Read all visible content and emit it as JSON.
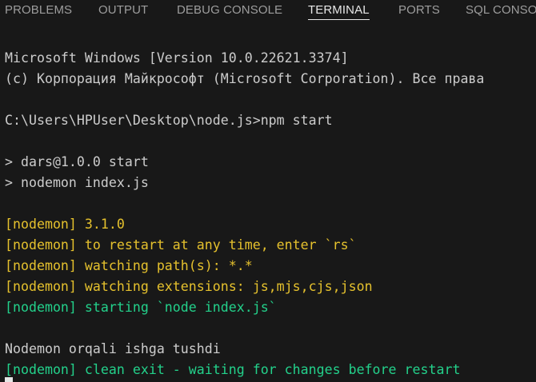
{
  "tabs": [
    {
      "label": "PROBLEMS"
    },
    {
      "label": "OUTPUT"
    },
    {
      "label": "DEBUG CONSOLE"
    },
    {
      "label": "TERMINAL"
    },
    {
      "label": "PORTS"
    },
    {
      "label": "SQL CONSO"
    }
  ],
  "active_tab": "TERMINAL",
  "colors": {
    "background": "#181818",
    "text": "#cccccc",
    "nodemon_info": "#e5c12d",
    "nodemon_status": "#23d18b"
  },
  "terminal": {
    "lines": [
      {
        "text": "Microsoft Windows [Version 10.0.22621.3374]",
        "color": "white"
      },
      {
        "text": "(c) Корпорация Майкрософт (Microsoft Corporation). Все права",
        "color": "white"
      },
      {
        "text": "",
        "color": "white"
      },
      {
        "text": "C:\\Users\\HPUser\\Desktop\\node.js>npm start",
        "color": "white"
      },
      {
        "text": "",
        "color": "white"
      },
      {
        "text": "> dars@1.0.0 start",
        "color": "white"
      },
      {
        "text": "> nodemon index.js",
        "color": "white"
      },
      {
        "text": "",
        "color": "white"
      },
      {
        "text": "[nodemon] 3.1.0",
        "color": "yellow"
      },
      {
        "text": "[nodemon] to restart at any time, enter `rs`",
        "color": "yellow"
      },
      {
        "text": "[nodemon] watching path(s): *.*",
        "color": "yellow"
      },
      {
        "text": "[nodemon] watching extensions: js,mjs,cjs,json",
        "color": "yellow"
      },
      {
        "text": "[nodemon] starting `node index.js`",
        "color": "green"
      },
      {
        "text": "",
        "color": "white"
      },
      {
        "text": "Nodemon orqali ishga tushdi",
        "color": "white"
      },
      {
        "text": "[nodemon] clean exit - waiting for changes before restart",
        "color": "green"
      }
    ]
  }
}
